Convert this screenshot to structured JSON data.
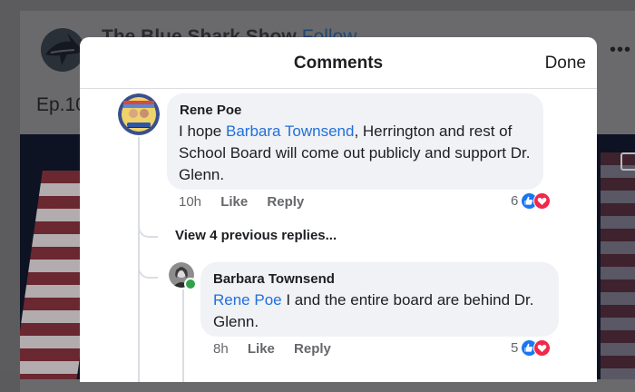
{
  "background": {
    "page_title": "The Blue Shark Show",
    "follow_label": "Follow",
    "episode_label": "Ep.10",
    "more_label": "•••"
  },
  "modal": {
    "title": "Comments",
    "done_label": "Done"
  },
  "comments": [
    {
      "author": "Rene Poe",
      "mention": "Barbara Townsend",
      "text_before": "I hope ",
      "text_after": ", Herrington and rest of School Board will come out publicly and support Dr. Glenn.",
      "time": "10h",
      "like_label": "Like",
      "reply_label": "Reply",
      "reaction_count": "6",
      "avatar_icon": "profile-avatar-icon"
    },
    {
      "author": "Barbara Townsend",
      "mention": "Rene Poe",
      "text_after": " I and the entire board are behind Dr. Glenn.",
      "time": "8h",
      "like_label": "Like",
      "reply_label": "Reply",
      "reaction_count": "5",
      "avatar_icon": "profile-avatar-icon"
    }
  ],
  "view_previous_replies": "View 4 previous replies...",
  "colors": {
    "mention": "#216fdb",
    "like_reaction": "#1877f2",
    "love_reaction": "#f0284a",
    "online": "#31a24c"
  }
}
